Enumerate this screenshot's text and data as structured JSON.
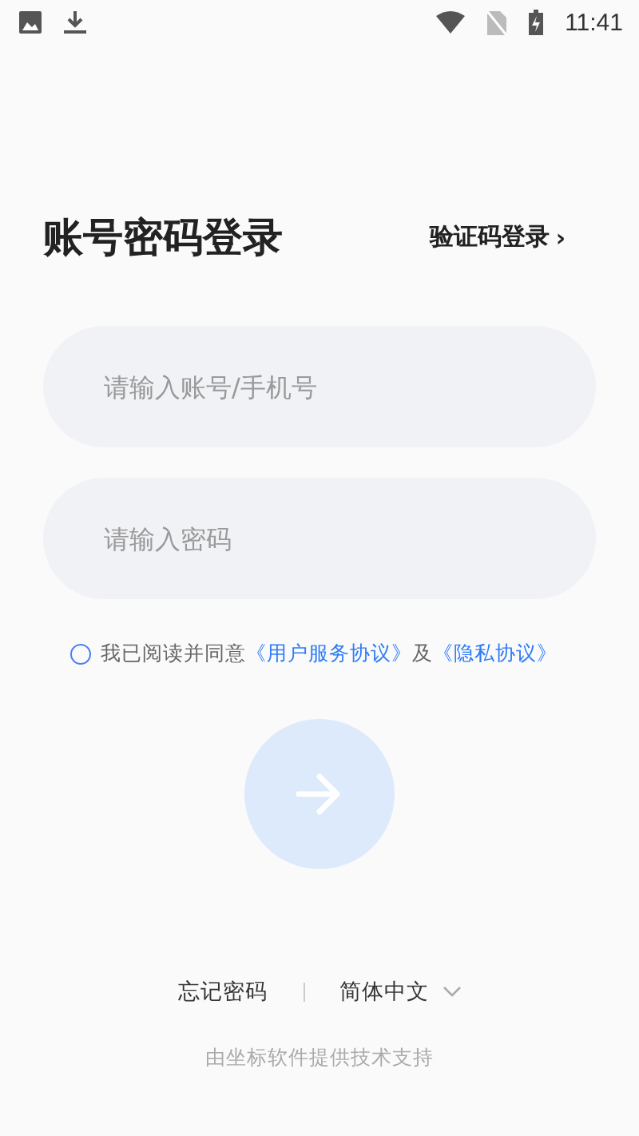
{
  "status_bar": {
    "time": "11:41"
  },
  "title": "账号密码登录",
  "switch_link": {
    "label": "验证码登录",
    "chevron": "›"
  },
  "fields": [
    {
      "placeholder": "请输入账号/手机号"
    },
    {
      "placeholder": "请输入密码"
    }
  ],
  "agreement": {
    "checked": false,
    "text": "我已阅读并同意",
    "link1": "《用户服务协议》",
    "joiner": "及",
    "link2": "《隐私协议》"
  },
  "submit": {
    "disabled": true
  },
  "footer": {
    "forgot": "忘记密码",
    "language": "简体中文"
  },
  "support": "由坐标软件提供技术支持"
}
